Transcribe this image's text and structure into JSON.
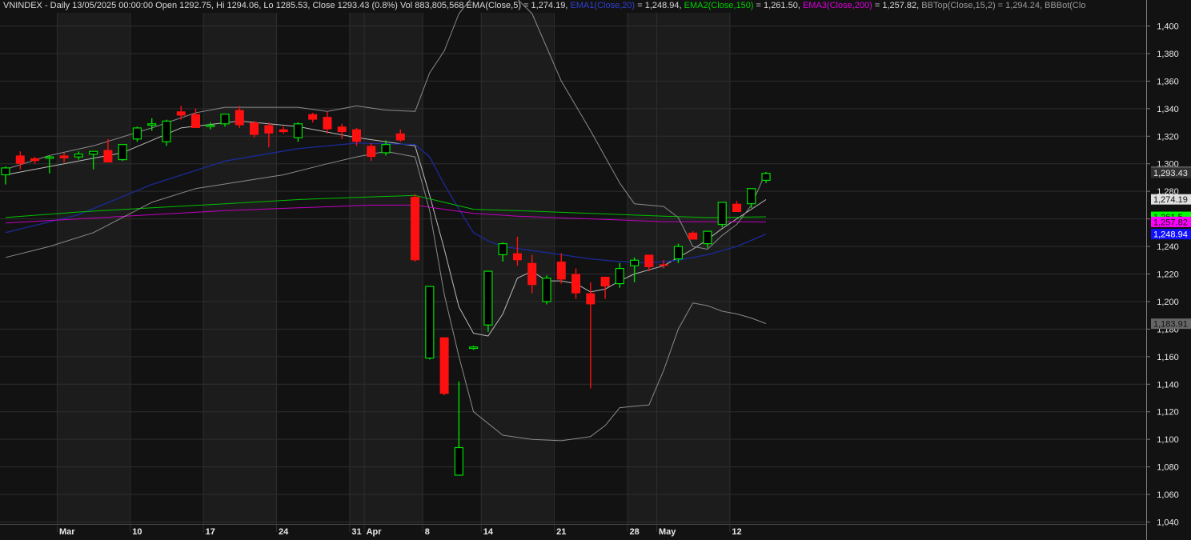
{
  "header": {
    "symbol_info": "VNINDEX - Daily 13/05/2025 00:00:00 Open 1292.75, Hi 1294.06, Lo 1285.53, Close 1293.43 (0.8%) Vol 883,805,568",
    "ema_label": "EMA(Close,5) = 1,274.19,",
    "ema1_label": "EMA1(Close,20)",
    "ema1_value": " = 1,248.94,",
    "ema2_label": "EMA2(Close,150)",
    "ema2_value": " = 1,261.50,",
    "ema3_label": "EMA3(Close,200)",
    "ema3_value": " = 1,257.82,",
    "bbtop_label": "BBTop(Close,15,2) = 1,294.24,",
    "bbbot_label": "BBBot(Clo"
  },
  "colors": {
    "background": "#121212",
    "background_alt": "#1c1c1c",
    "up": "#00e000",
    "down": "#ff1010",
    "ema5": "#bbbbbb",
    "ema20": "#1a2a9a",
    "ema150": "#00c000",
    "ema200": "#c000c0",
    "bollinger": "#8a8a8a"
  },
  "chart_data": {
    "type": "candlestick",
    "ylim": [
      1030,
      1410
    ],
    "y_ticks": [
      1040,
      1060,
      1080,
      1100,
      1120,
      1140,
      1160,
      1180,
      1200,
      1220,
      1240,
      1260,
      1280,
      1300,
      1320,
      1340,
      1360,
      1380,
      1400
    ],
    "y_tick_labels": [
      "1,040",
      "1,060",
      "1,080",
      "1,100",
      "1,120",
      "1,140",
      "1,160",
      "1,180",
      "1,200",
      "1,220",
      "1,240",
      "1,260",
      "1,280",
      "1,300",
      "1,320",
      "1,340",
      "1,360",
      "1,380",
      "1,400"
    ],
    "x_labels": [
      {
        "label": "Mar",
        "index": 4
      },
      {
        "label": "10",
        "index": 9
      },
      {
        "label": "17",
        "index": 14
      },
      {
        "label": "24",
        "index": 19
      },
      {
        "label": "31",
        "index": 24
      },
      {
        "label": "Apr",
        "index": 25
      },
      {
        "label": "8",
        "index": 29
      },
      {
        "label": "14",
        "index": 33
      },
      {
        "label": "21",
        "index": 38
      },
      {
        "label": "28",
        "index": 43
      },
      {
        "label": "May",
        "index": 45
      },
      {
        "label": "12",
        "index": 50
      }
    ],
    "candles": [
      {
        "o": 1292,
        "h": 1298,
        "l": 1285,
        "c": 1297
      },
      {
        "o": 1306,
        "h": 1309,
        "l": 1296,
        "c": 1300
      },
      {
        "o": 1304,
        "h": 1305,
        "l": 1300,
        "c": 1302
      },
      {
        "o": 1304,
        "h": 1306,
        "l": 1293,
        "c": 1305
      },
      {
        "o": 1306,
        "h": 1308,
        "l": 1301,
        "c": 1304
      },
      {
        "o": 1305,
        "h": 1309,
        "l": 1303,
        "c": 1307
      },
      {
        "o": 1307,
        "h": 1309,
        "l": 1296,
        "c": 1309
      },
      {
        "o": 1310,
        "h": 1318,
        "l": 1301,
        "c": 1301
      },
      {
        "o": 1303,
        "h": 1314,
        "l": 1302,
        "c": 1314
      },
      {
        "o": 1318,
        "h": 1327,
        "l": 1316,
        "c": 1326
      },
      {
        "o": 1328,
        "h": 1333,
        "l": 1324,
        "c": 1329
      },
      {
        "o": 1316,
        "h": 1332,
        "l": 1313,
        "c": 1331
      },
      {
        "o": 1338,
        "h": 1342,
        "l": 1332,
        "c": 1335
      },
      {
        "o": 1336,
        "h": 1340,
        "l": 1326,
        "c": 1326
      },
      {
        "o": 1327,
        "h": 1330,
        "l": 1325,
        "c": 1328
      },
      {
        "o": 1329,
        "h": 1336,
        "l": 1327,
        "c": 1336
      },
      {
        "o": 1339,
        "h": 1342,
        "l": 1326,
        "c": 1328
      },
      {
        "o": 1330,
        "h": 1331,
        "l": 1319,
        "c": 1321
      },
      {
        "o": 1328,
        "h": 1330,
        "l": 1312,
        "c": 1322
      },
      {
        "o": 1325,
        "h": 1327,
        "l": 1322,
        "c": 1323
      },
      {
        "o": 1319,
        "h": 1330,
        "l": 1316,
        "c": 1329
      },
      {
        "o": 1336,
        "h": 1337,
        "l": 1330,
        "c": 1332
      },
      {
        "o": 1334,
        "h": 1338,
        "l": 1322,
        "c": 1325
      },
      {
        "o": 1327,
        "h": 1329,
        "l": 1318,
        "c": 1323
      },
      {
        "o": 1325,
        "h": 1326,
        "l": 1313,
        "c": 1316
      },
      {
        "o": 1313,
        "h": 1315,
        "l": 1302,
        "c": 1305
      },
      {
        "o": 1308,
        "h": 1317,
        "l": 1306,
        "c": 1314
      },
      {
        "o": 1322,
        "h": 1325,
        "l": 1316,
        "c": 1317
      },
      {
        "o": 1276,
        "h": 1278,
        "l": 1229,
        "c": 1230
      },
      {
        "o": 1159,
        "h": 1211,
        "l": 1158,
        "c": 1211
      },
      {
        "o": 1174,
        "h": 1174,
        "l": 1132,
        "c": 1133
      },
      {
        "o": 1074,
        "h": 1142,
        "l": 1074,
        "c": 1094
      },
      {
        "o": 1166,
        "h": 1168,
        "l": 1165,
        "c": 1167
      },
      {
        "o": 1183,
        "h": 1222,
        "l": 1178,
        "c": 1222
      },
      {
        "o": 1234,
        "h": 1243,
        "l": 1229,
        "c": 1242
      },
      {
        "o": 1235,
        "h": 1247,
        "l": 1226,
        "c": 1230
      },
      {
        "o": 1228,
        "h": 1234,
        "l": 1206,
        "c": 1212
      },
      {
        "o": 1200,
        "h": 1219,
        "l": 1198,
        "c": 1217
      },
      {
        "o": 1229,
        "h": 1235,
        "l": 1213,
        "c": 1216
      },
      {
        "o": 1220,
        "h": 1224,
        "l": 1202,
        "c": 1206
      },
      {
        "o": 1206,
        "h": 1214,
        "l": 1137,
        "c": 1198
      },
      {
        "o": 1218,
        "h": 1218,
        "l": 1202,
        "c": 1211
      },
      {
        "o": 1213,
        "h": 1228,
        "l": 1210,
        "c": 1224
      },
      {
        "o": 1226,
        "h": 1232,
        "l": 1214,
        "c": 1230
      },
      {
        "o": 1234,
        "h": 1234,
        "l": 1222,
        "c": 1225
      },
      {
        "o": 1227,
        "h": 1230,
        "l": 1224,
        "c": 1226
      },
      {
        "o": 1231,
        "h": 1242,
        "l": 1228,
        "c": 1240
      },
      {
        "o": 1250,
        "h": 1251,
        "l": 1245,
        "c": 1245
      },
      {
        "o": 1242,
        "h": 1251,
        "l": 1239,
        "c": 1251
      },
      {
        "o": 1256,
        "h": 1272,
        "l": 1254,
        "c": 1272
      },
      {
        "o": 1271,
        "h": 1273,
        "l": 1265,
        "c": 1265
      },
      {
        "o": 1271,
        "h": 1282,
        "l": 1268,
        "c": 1282
      },
      {
        "o": 1288,
        "h": 1294,
        "l": 1286,
        "c": 1293
      }
    ],
    "series": [
      {
        "key": "ema5",
        "values": [
          [
            0,
            1292
          ],
          [
            4,
            1300
          ],
          [
            8,
            1308
          ],
          [
            12,
            1326
          ],
          [
            16,
            1331
          ],
          [
            20,
            1327
          ],
          [
            24,
            1319
          ],
          [
            28,
            1313
          ],
          [
            29,
            1277
          ],
          [
            30,
            1238
          ],
          [
            31,
            1196
          ],
          [
            32,
            1177
          ],
          [
            33,
            1175
          ],
          [
            34,
            1191
          ],
          [
            35,
            1217
          ],
          [
            36,
            1222
          ],
          [
            37,
            1215
          ],
          [
            38,
            1215
          ],
          [
            39,
            1213
          ],
          [
            40,
            1207
          ],
          [
            41,
            1209
          ],
          [
            42,
            1215
          ],
          [
            43,
            1220
          ],
          [
            44,
            1223
          ],
          [
            45,
            1226
          ],
          [
            46,
            1232
          ],
          [
            47,
            1238
          ],
          [
            48,
            1245
          ],
          [
            49,
            1253
          ],
          [
            50,
            1260
          ],
          [
            52,
            1274
          ]
        ]
      },
      {
        "key": "ema20",
        "values": [
          [
            0,
            1250
          ],
          [
            5,
            1263
          ],
          [
            10,
            1285
          ],
          [
            15,
            1302
          ],
          [
            20,
            1311
          ],
          [
            24,
            1315
          ],
          [
            28,
            1314
          ],
          [
            29,
            1305
          ],
          [
            30,
            1285
          ],
          [
            31,
            1267
          ],
          [
            32,
            1250
          ],
          [
            33,
            1244
          ],
          [
            34,
            1240
          ],
          [
            36,
            1237
          ],
          [
            38,
            1234
          ],
          [
            40,
            1231
          ],
          [
            42,
            1229
          ],
          [
            44,
            1228
          ],
          [
            46,
            1230
          ],
          [
            48,
            1234
          ],
          [
            50,
            1240
          ],
          [
            52,
            1249
          ]
        ]
      },
      {
        "key": "ema150",
        "values": [
          [
            0,
            1261
          ],
          [
            5,
            1265
          ],
          [
            10,
            1268
          ],
          [
            15,
            1271
          ],
          [
            20,
            1274
          ],
          [
            25,
            1276
          ],
          [
            28,
            1277
          ],
          [
            30,
            1272
          ],
          [
            32,
            1267
          ],
          [
            35,
            1266
          ],
          [
            40,
            1264
          ],
          [
            45,
            1262
          ],
          [
            48,
            1261
          ],
          [
            52,
            1261.5
          ]
        ]
      },
      {
        "key": "ema200",
        "values": [
          [
            0,
            1257
          ],
          [
            5,
            1260
          ],
          [
            10,
            1263
          ],
          [
            15,
            1266
          ],
          [
            20,
            1268
          ],
          [
            25,
            1270
          ],
          [
            28,
            1270
          ],
          [
            30,
            1267
          ],
          [
            32,
            1264
          ],
          [
            35,
            1262
          ],
          [
            40,
            1260
          ],
          [
            45,
            1258
          ],
          [
            48,
            1258
          ],
          [
            52,
            1257.8
          ]
        ]
      },
      {
        "key": "bbtop",
        "values": [
          [
            0,
            1296
          ],
          [
            3,
            1306
          ],
          [
            6,
            1313
          ],
          [
            10,
            1326
          ],
          [
            13,
            1337
          ],
          [
            15,
            1341
          ],
          [
            20,
            1341
          ],
          [
            22,
            1338
          ],
          [
            24,
            1342
          ],
          [
            26,
            1339
          ],
          [
            28,
            1338
          ],
          [
            29,
            1366
          ],
          [
            30,
            1382
          ],
          [
            31,
            1409
          ],
          [
            32,
            1422
          ],
          [
            34,
            1430
          ],
          [
            36,
            1409
          ],
          [
            38,
            1360
          ],
          [
            40,
            1324
          ],
          [
            42,
            1286
          ],
          [
            43,
            1271
          ],
          [
            45,
            1269
          ],
          [
            46,
            1261
          ],
          [
            47,
            1240
          ],
          [
            48,
            1238
          ],
          [
            49,
            1248
          ],
          [
            50,
            1256
          ],
          [
            51,
            1270
          ],
          [
            52,
            1294
          ]
        ]
      },
      {
        "key": "bbbot",
        "values": [
          [
            0,
            1232
          ],
          [
            3,
            1240
          ],
          [
            6,
            1250
          ],
          [
            10,
            1272
          ],
          [
            13,
            1282
          ],
          [
            16,
            1287
          ],
          [
            19,
            1292
          ],
          [
            22,
            1300
          ],
          [
            24,
            1305
          ],
          [
            26,
            1309
          ],
          [
            28,
            1305
          ],
          [
            29,
            1266
          ],
          [
            30,
            1205
          ],
          [
            31,
            1160
          ],
          [
            32,
            1120
          ],
          [
            34,
            1103
          ],
          [
            36,
            1100
          ],
          [
            38,
            1099
          ],
          [
            40,
            1102
          ],
          [
            41,
            1110
          ],
          [
            42,
            1123
          ],
          [
            43,
            1124
          ],
          [
            44,
            1125
          ],
          [
            45,
            1150
          ],
          [
            46,
            1180
          ],
          [
            47,
            1199
          ],
          [
            48,
            1197
          ],
          [
            49,
            1193
          ],
          [
            50,
            1191
          ],
          [
            51,
            1188
          ],
          [
            52,
            1184
          ]
        ]
      }
    ],
    "price_tags": [
      {
        "label": "1,294.24",
        "value": 1294.24,
        "bg": "#666666",
        "fg": "#111111"
      },
      {
        "label": "1,293.43",
        "value": 1293.43,
        "bg": "#303030",
        "fg": "#e8e8e8"
      },
      {
        "label": "1,274.19",
        "value": 1274.19,
        "bg": "#e0e0e0",
        "fg": "#111111"
      },
      {
        "label": "1,261.5",
        "value": 1261.5,
        "bg": "#00ff00",
        "fg": "#111111"
      },
      {
        "label": "1,257.82",
        "value": 1257.82,
        "bg": "#ff00ff",
        "fg": "#111111"
      },
      {
        "label": "1,248.94",
        "value": 1248.94,
        "bg": "#1010ff",
        "fg": "#ffffff"
      },
      {
        "label": "1,183.91",
        "value": 1183.91,
        "bg": "#666666",
        "fg": "#111111"
      }
    ]
  }
}
